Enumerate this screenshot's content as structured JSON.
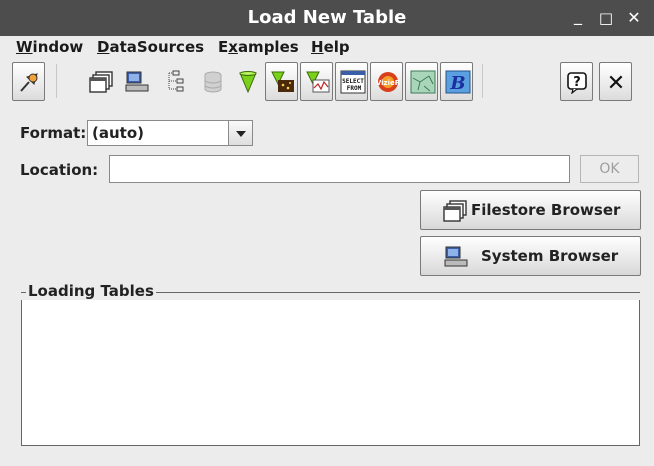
{
  "window": {
    "title": "Load New Table",
    "minimize_label": "_",
    "maximize_label": "□",
    "close_label": "✕"
  },
  "menubar": {
    "items": [
      {
        "label_pre": "",
        "mnemonic": "W",
        "label_post": "indow"
      },
      {
        "label_pre": "",
        "mnemonic": "D",
        "label_post": "ataSources"
      },
      {
        "label_pre": "E",
        "mnemonic": "x",
        "label_post": "amples"
      },
      {
        "label_pre": "",
        "mnemonic": "H",
        "label_post": "elp"
      }
    ]
  },
  "toolbar": {
    "icons": [
      "pin-icon",
      "filestore-icon",
      "system-browser-icon",
      "tree-icon",
      "database-icon",
      "cone-icon",
      "cone-data-icon",
      "cone-chart-icon",
      "select-from-icon",
      "vizier-icon",
      "sky-map-icon",
      "b-icon",
      "help-icon",
      "close-icon"
    ],
    "select_from_text_1": "SELECT",
    "select_from_text_2": "FROM",
    "vizier_text": "VizieR",
    "b_text": "B",
    "help_text": "?",
    "close_text": "✕"
  },
  "form": {
    "format_label": "Format:",
    "format_value": "(auto)",
    "location_label": "Location:",
    "location_value": "",
    "ok_label": "OK"
  },
  "buttons": {
    "filestore_label": "Filestore Browser",
    "system_label": "System Browser"
  },
  "loading": {
    "title": "Loading Tables"
  },
  "colors": {
    "titlebar": "#4d4d4d",
    "background": "#ececec"
  }
}
